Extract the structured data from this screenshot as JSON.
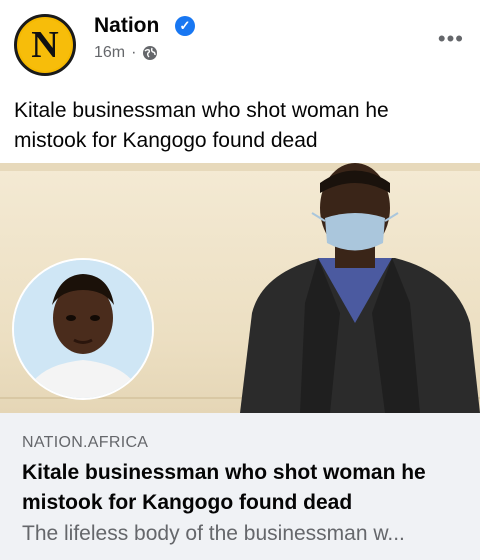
{
  "post": {
    "page_name": "Nation",
    "avatar_letter": "N",
    "time": "16m",
    "separator": "·",
    "audience_icon": "globe-icon",
    "verified_icon": "verified-badge-icon",
    "more_icon": "more-options-icon",
    "caption": "Kitale businessman who shot woman he mistook for Kangogo found dead"
  },
  "link_preview": {
    "domain": "NATION.AFRICA",
    "title": "Kitale businessman who shot woman he mistook for Kangogo found dead",
    "description": "The lifeless body of the businessman w..."
  },
  "colors": {
    "brand_yellow": "#f5b800",
    "verified_blue": "#1877f2",
    "secondary_text": "#65676b",
    "link_bg": "#f0f2f5"
  }
}
